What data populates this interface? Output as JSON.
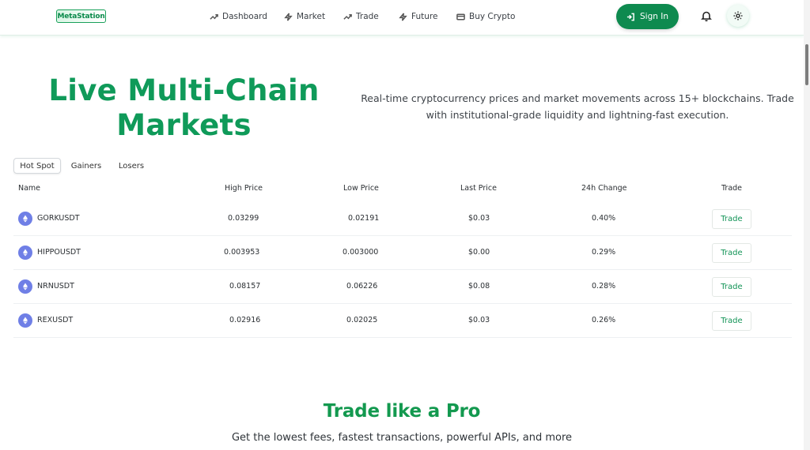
{
  "header": {
    "logo_text": "MetaStation",
    "nav": [
      {
        "label": "Dashboard",
        "icon": "trending-up-icon"
      },
      {
        "label": "Market",
        "icon": "lightning-icon"
      },
      {
        "label": "Trade",
        "icon": "trending-up-icon"
      },
      {
        "label": "Future",
        "icon": "lightning-icon"
      },
      {
        "label": "Buy Crypto",
        "icon": "card-icon"
      }
    ],
    "signin_label": "Sign In",
    "accent_color": "#0e8a4f"
  },
  "hero": {
    "title_line1": "Live Multi-Chain",
    "title_line2": "Markets",
    "description": "Real-time cryptocurrency prices and market movements across 15+ blockchains. Trade with institutional-grade liquidity and lightning-fast execution."
  },
  "tabs": [
    "Hot Spot",
    "Gainers",
    "Losers"
  ],
  "table": {
    "headers": [
      "Name",
      "High Price",
      "Low Price",
      "Last Price",
      "24h Change",
      "Trade"
    ],
    "rows": [
      {
        "name": "GORKUSDT",
        "high": "0.03299",
        "low": "0.02191",
        "last": "$0.03",
        "change": "0.40%",
        "action": "Trade"
      },
      {
        "name": "HIPPOUSDT",
        "high": "0.003953",
        "low": "0.003000",
        "last": "$0.00",
        "change": "0.29%",
        "action": "Trade"
      },
      {
        "name": "NRNUSDT",
        "high": "0.08157",
        "low": "0.06226",
        "last": "$0.08",
        "change": "0.28%",
        "action": "Trade"
      },
      {
        "name": "REXUSDT",
        "high": "0.02916",
        "low": "0.02025",
        "last": "$0.03",
        "change": "0.26%",
        "action": "Trade"
      }
    ]
  },
  "pro": {
    "title": "Trade like a Pro",
    "subtitle": "Get the lowest fees, fastest transactions, powerful APIs, and more"
  }
}
